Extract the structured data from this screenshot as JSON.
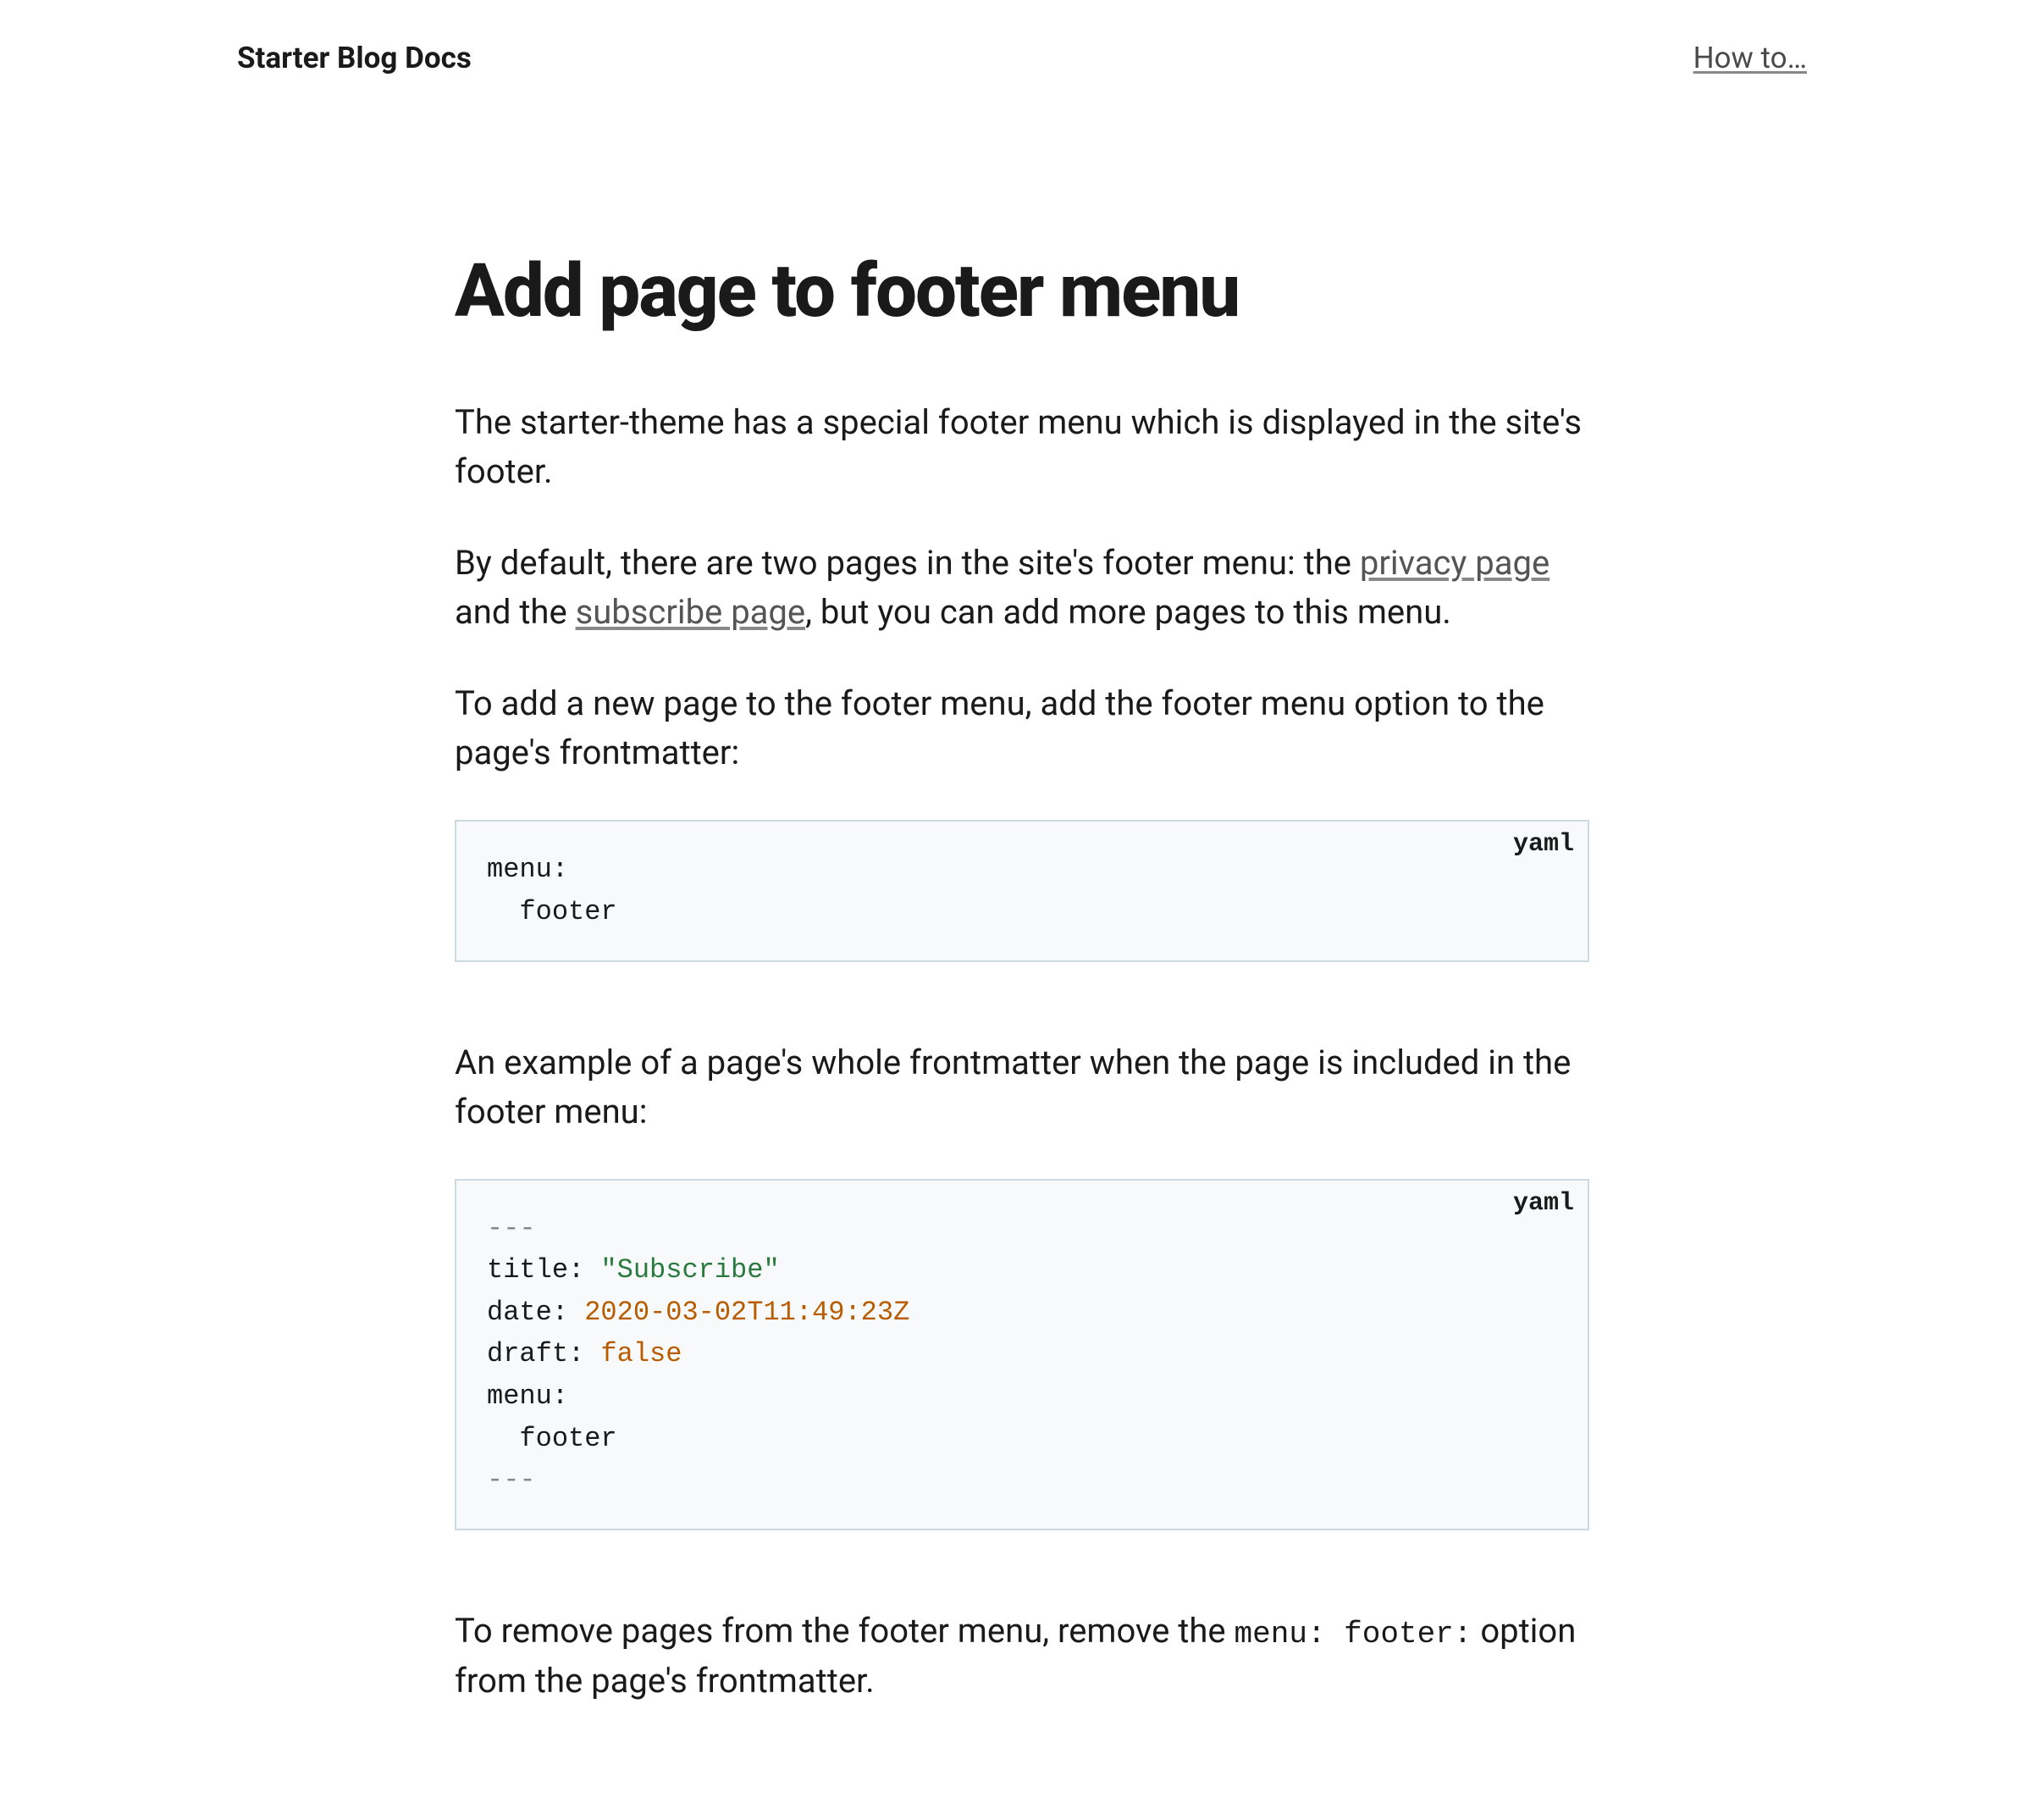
{
  "header": {
    "site_title": "Starter Blog Docs",
    "nav_link": "How to…"
  },
  "article": {
    "title": "Add page to footer menu",
    "p1": "The starter-theme has a special footer menu which is displayed in the site's footer.",
    "p2_pre": "By default, there are two pages in the site's footer menu: the ",
    "p2_link1": "privacy page",
    "p2_mid": " and the ",
    "p2_link2": "subscribe page",
    "p2_post": ", but you can add more pages to this menu.",
    "p3": "To add a new page to the footer menu, add the footer menu option to the page's frontmatter:",
    "code1": {
      "lang": "yaml",
      "line1_key": "menu:",
      "line2_val": "  footer"
    },
    "p4": "An example of a page's whole frontmatter when the page is included in the footer menu:",
    "code2": {
      "lang": "yaml",
      "delim": "---",
      "l1_key": "title:",
      "l1_val": " \"Subscribe\"",
      "l2_key": "date:",
      "l2_val": " 2020-03-02T11:49:23Z",
      "l3_key": "draft:",
      "l3_val": " false",
      "l4_key": "menu:",
      "l5_val": "  footer"
    },
    "p5_pre": "To remove pages from the footer menu, remove the ",
    "p5_code": "menu: footer:",
    "p5_post": " option from the page's frontmatter."
  }
}
